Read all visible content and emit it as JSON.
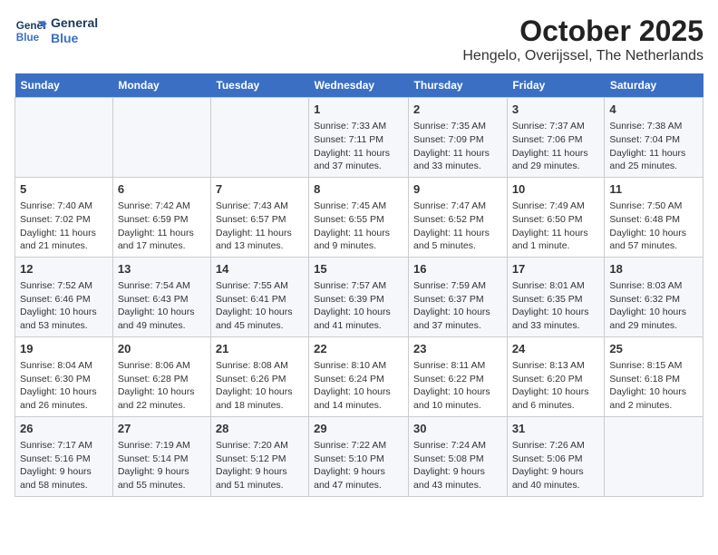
{
  "logo": {
    "line1": "General",
    "line2": "Blue"
  },
  "title": "October 2025",
  "subtitle": "Hengelo, Overijssel, The Netherlands",
  "headers": [
    "Sunday",
    "Monday",
    "Tuesday",
    "Wednesday",
    "Thursday",
    "Friday",
    "Saturday"
  ],
  "weeks": [
    [
      {
        "day": "",
        "info": ""
      },
      {
        "day": "",
        "info": ""
      },
      {
        "day": "",
        "info": ""
      },
      {
        "day": "1",
        "info": "Sunrise: 7:33 AM\nSunset: 7:11 PM\nDaylight: 11 hours and 37 minutes."
      },
      {
        "day": "2",
        "info": "Sunrise: 7:35 AM\nSunset: 7:09 PM\nDaylight: 11 hours and 33 minutes."
      },
      {
        "day": "3",
        "info": "Sunrise: 7:37 AM\nSunset: 7:06 PM\nDaylight: 11 hours and 29 minutes."
      },
      {
        "day": "4",
        "info": "Sunrise: 7:38 AM\nSunset: 7:04 PM\nDaylight: 11 hours and 25 minutes."
      }
    ],
    [
      {
        "day": "5",
        "info": "Sunrise: 7:40 AM\nSunset: 7:02 PM\nDaylight: 11 hours and 21 minutes."
      },
      {
        "day": "6",
        "info": "Sunrise: 7:42 AM\nSunset: 6:59 PM\nDaylight: 11 hours and 17 minutes."
      },
      {
        "day": "7",
        "info": "Sunrise: 7:43 AM\nSunset: 6:57 PM\nDaylight: 11 hours and 13 minutes."
      },
      {
        "day": "8",
        "info": "Sunrise: 7:45 AM\nSunset: 6:55 PM\nDaylight: 11 hours and 9 minutes."
      },
      {
        "day": "9",
        "info": "Sunrise: 7:47 AM\nSunset: 6:52 PM\nDaylight: 11 hours and 5 minutes."
      },
      {
        "day": "10",
        "info": "Sunrise: 7:49 AM\nSunset: 6:50 PM\nDaylight: 11 hours and 1 minute."
      },
      {
        "day": "11",
        "info": "Sunrise: 7:50 AM\nSunset: 6:48 PM\nDaylight: 10 hours and 57 minutes."
      }
    ],
    [
      {
        "day": "12",
        "info": "Sunrise: 7:52 AM\nSunset: 6:46 PM\nDaylight: 10 hours and 53 minutes."
      },
      {
        "day": "13",
        "info": "Sunrise: 7:54 AM\nSunset: 6:43 PM\nDaylight: 10 hours and 49 minutes."
      },
      {
        "day": "14",
        "info": "Sunrise: 7:55 AM\nSunset: 6:41 PM\nDaylight: 10 hours and 45 minutes."
      },
      {
        "day": "15",
        "info": "Sunrise: 7:57 AM\nSunset: 6:39 PM\nDaylight: 10 hours and 41 minutes."
      },
      {
        "day": "16",
        "info": "Sunrise: 7:59 AM\nSunset: 6:37 PM\nDaylight: 10 hours and 37 minutes."
      },
      {
        "day": "17",
        "info": "Sunrise: 8:01 AM\nSunset: 6:35 PM\nDaylight: 10 hours and 33 minutes."
      },
      {
        "day": "18",
        "info": "Sunrise: 8:03 AM\nSunset: 6:32 PM\nDaylight: 10 hours and 29 minutes."
      }
    ],
    [
      {
        "day": "19",
        "info": "Sunrise: 8:04 AM\nSunset: 6:30 PM\nDaylight: 10 hours and 26 minutes."
      },
      {
        "day": "20",
        "info": "Sunrise: 8:06 AM\nSunset: 6:28 PM\nDaylight: 10 hours and 22 minutes."
      },
      {
        "day": "21",
        "info": "Sunrise: 8:08 AM\nSunset: 6:26 PM\nDaylight: 10 hours and 18 minutes."
      },
      {
        "day": "22",
        "info": "Sunrise: 8:10 AM\nSunset: 6:24 PM\nDaylight: 10 hours and 14 minutes."
      },
      {
        "day": "23",
        "info": "Sunrise: 8:11 AM\nSunset: 6:22 PM\nDaylight: 10 hours and 10 minutes."
      },
      {
        "day": "24",
        "info": "Sunrise: 8:13 AM\nSunset: 6:20 PM\nDaylight: 10 hours and 6 minutes."
      },
      {
        "day": "25",
        "info": "Sunrise: 8:15 AM\nSunset: 6:18 PM\nDaylight: 10 hours and 2 minutes."
      }
    ],
    [
      {
        "day": "26",
        "info": "Sunrise: 7:17 AM\nSunset: 5:16 PM\nDaylight: 9 hours and 58 minutes."
      },
      {
        "day": "27",
        "info": "Sunrise: 7:19 AM\nSunset: 5:14 PM\nDaylight: 9 hours and 55 minutes."
      },
      {
        "day": "28",
        "info": "Sunrise: 7:20 AM\nSunset: 5:12 PM\nDaylight: 9 hours and 51 minutes."
      },
      {
        "day": "29",
        "info": "Sunrise: 7:22 AM\nSunset: 5:10 PM\nDaylight: 9 hours and 47 minutes."
      },
      {
        "day": "30",
        "info": "Sunrise: 7:24 AM\nSunset: 5:08 PM\nDaylight: 9 hours and 43 minutes."
      },
      {
        "day": "31",
        "info": "Sunrise: 7:26 AM\nSunset: 5:06 PM\nDaylight: 9 hours and 40 minutes."
      },
      {
        "day": "",
        "info": ""
      }
    ]
  ]
}
